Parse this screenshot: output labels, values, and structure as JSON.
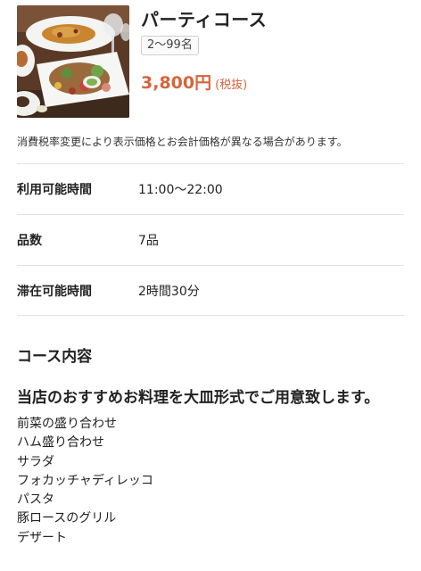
{
  "course": {
    "title": "パーティコース",
    "capacity_badge": "2～99名",
    "price": "3,800円",
    "tax_note": "(税抜)",
    "photo_icon": "food-photo"
  },
  "notice": "消費税率変更により表示価格とお会計価格が異なる場合があります。",
  "info": {
    "rows": [
      {
        "label": "利用可能時間",
        "value": "11:00～22:00"
      },
      {
        "label": "品数",
        "value": "7品"
      },
      {
        "label": "滞在可能時間",
        "value": "2時間30分"
      }
    ]
  },
  "contents": {
    "heading": "コース内容",
    "lead": "当店のおすすめお料理を大皿形式でご用意致します。",
    "items": [
      "前菜の盛り合わせ",
      "ハム盛り合わせ",
      "サラダ",
      "フォカッチャディレッコ",
      "パスタ",
      "豚ロースのグリル",
      "デザート"
    ]
  },
  "colors": {
    "price": "#d8643c",
    "divider": "#e3e3e3"
  }
}
